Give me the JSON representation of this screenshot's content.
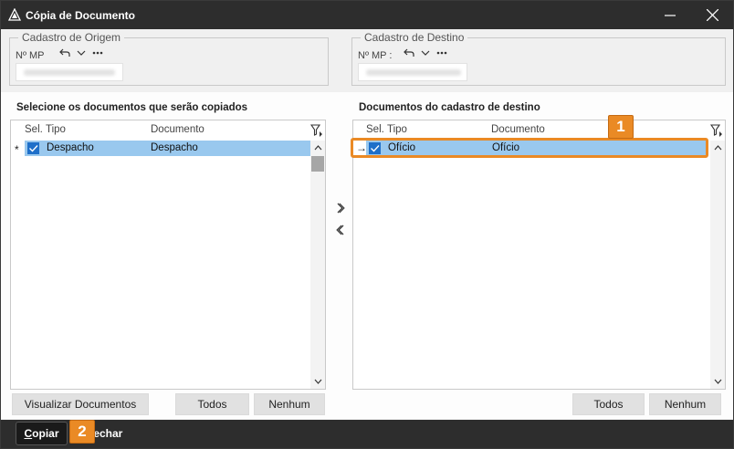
{
  "window": {
    "title": "Cópia de Documento"
  },
  "origin": {
    "legend": "Cadastro de Origem",
    "field_label": "Nº MP"
  },
  "destination": {
    "legend": "Cadastro de Destino",
    "field_label": "Nº MP :"
  },
  "left_panel": {
    "title": "Selecione os documentos que serão copiados",
    "columns": {
      "sel": "Sel.",
      "tipo": "Tipo",
      "documento": "Documento"
    },
    "rows": [
      {
        "indicator": "*",
        "tipo": "Despacho",
        "documento": "Despacho"
      }
    ],
    "buttons": {
      "visualizar": "Visualizar Documentos",
      "todos": "Todos",
      "nenhum": "Nenhum"
    }
  },
  "right_panel": {
    "title": "Documentos do cadastro de destino",
    "columns": {
      "sel": "Sel.",
      "tipo": "Tipo",
      "documento": "Documento"
    },
    "rows": [
      {
        "indicator": "→",
        "tipo": "Ofício",
        "documento": "Ofício"
      }
    ],
    "buttons": {
      "todos": "Todos",
      "nenhum": "Nenhum"
    }
  },
  "footer": {
    "copiar_first": "C",
    "copiar_rest": "opiar",
    "fechar": "Fechar"
  },
  "callouts": {
    "one": "1",
    "two": "2"
  },
  "colors": {
    "accent": "#ea8a25",
    "selection": "#99c8ee",
    "titlebar": "#2d2d2d",
    "checkbox": "#1e6fc9"
  },
  "icons": [
    "app-icon",
    "minimize-icon",
    "close-icon",
    "undo-icon",
    "chevron-down-icon",
    "more-icon",
    "filter-icon",
    "move-right-icon",
    "move-left-icon",
    "scroll-up-icon",
    "scroll-down-icon",
    "checkmark-icon"
  ]
}
